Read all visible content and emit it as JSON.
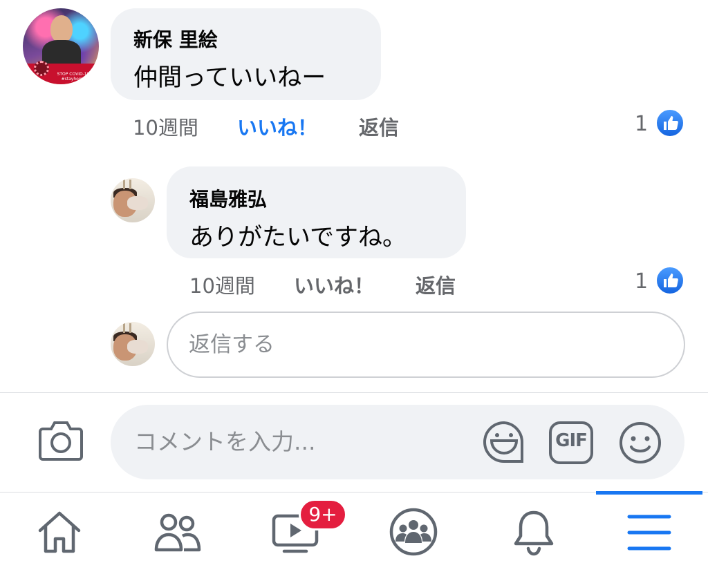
{
  "comments": [
    {
      "author": "新保 里絵",
      "text": "仲間っていいねー",
      "time": "10週間",
      "like_label": "いいね！",
      "reply_label": "返信",
      "reaction_count": "1",
      "avatar_caption": "STOP COVID-19 #stayhome"
    }
  ],
  "replies": [
    {
      "author": "福島雅弘",
      "text": "ありがたいですね。",
      "time": "10週間",
      "like_label": "いいね！",
      "reply_label": "返信",
      "reaction_count": "1"
    }
  ],
  "reply_input": {
    "placeholder": "返信する",
    "value": ""
  },
  "composer": {
    "placeholder": "コメントを入力...",
    "value": "",
    "gif_label": "GIF"
  },
  "bottom_nav": {
    "items": [
      {
        "name": "home",
        "icon": "home-icon"
      },
      {
        "name": "friends",
        "icon": "friends-icon"
      },
      {
        "name": "watch",
        "icon": "video-icon",
        "badge": "9+"
      },
      {
        "name": "groups",
        "icon": "groups-icon"
      },
      {
        "name": "notifications",
        "icon": "bell-icon"
      },
      {
        "name": "menu",
        "icon": "menu-icon",
        "active": true
      }
    ]
  },
  "colors": {
    "accent": "#1877f2",
    "bubble": "#f0f2f5",
    "secondary_text": "#65676b",
    "badge_red": "#e41e3f"
  }
}
